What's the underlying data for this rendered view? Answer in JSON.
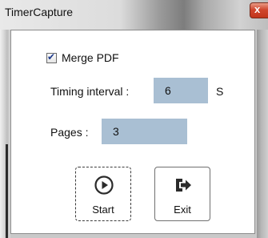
{
  "window": {
    "title": "TimerCapture",
    "close_glyph": "x"
  },
  "merge_pdf": {
    "label": "Merge PDF",
    "checked": true
  },
  "timing_interval": {
    "label": "Timing interval :",
    "value": "6",
    "unit": "S"
  },
  "pages": {
    "label": "Pages :",
    "value": "3"
  },
  "buttons": {
    "start_label": "Start",
    "start_icon": "play-circle-icon",
    "exit_label": "Exit",
    "exit_icon": "exit-arrow-icon"
  },
  "colors": {
    "input_background": "#a9bfd3",
    "close_button": "#c2351b"
  }
}
